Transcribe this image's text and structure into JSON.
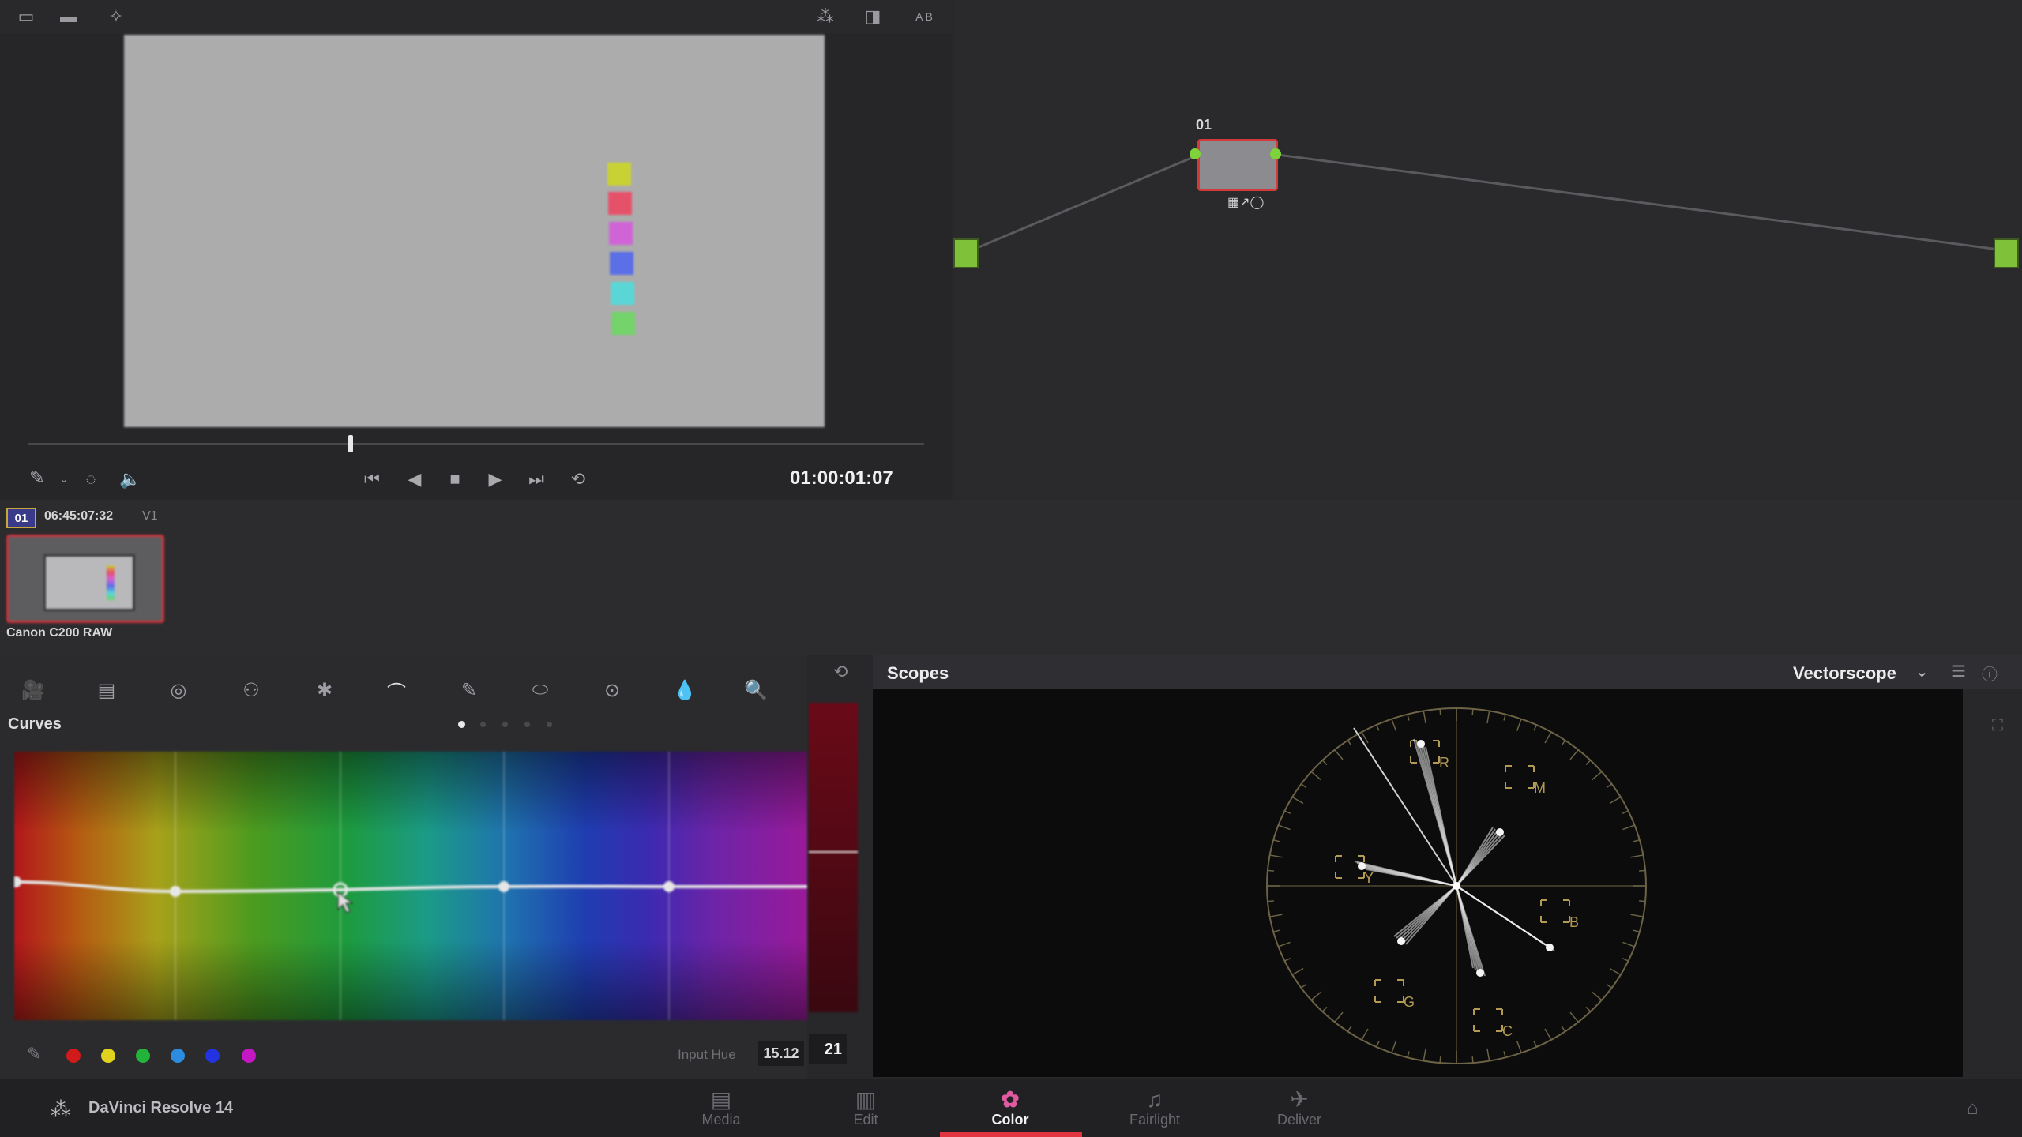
{
  "viewer": {
    "toolbar_right_label": "A B",
    "timecode": "01:00:01:07",
    "playhead_fraction": 0.36,
    "chip_colors": [
      "#c8d234",
      "#e6516a",
      "#d064d6",
      "#5b6fe6",
      "#5ad6d6",
      "#74d36a"
    ]
  },
  "node_editor": {
    "node_label": "01"
  },
  "clip": {
    "number": "01",
    "timecode": "06:45:07:32",
    "track": "V1",
    "name": "Canon C200 RAW"
  },
  "curves": {
    "title": "Curves",
    "input_hue_label": "Input Hue",
    "input_hue_value": "15.12",
    "swatch_colors": [
      "#d11a1a",
      "#e0d21e",
      "#22b33a",
      "#2b8ce0",
      "#2233e0",
      "#c418c4"
    ]
  },
  "scopes": {
    "title": "Scopes",
    "mode": "Vectorscope",
    "mode_chevron": "chevron-down-icon",
    "overlap_value": "21",
    "targets": [
      "R",
      "M",
      "B",
      "C",
      "G",
      "Y"
    ]
  },
  "app": {
    "name": "DaVinci Resolve 14",
    "pages": [
      "Media",
      "Edit",
      "Color",
      "Fairlight",
      "Deliver"
    ],
    "active_page": "Color",
    "accent": "#e0353f"
  }
}
